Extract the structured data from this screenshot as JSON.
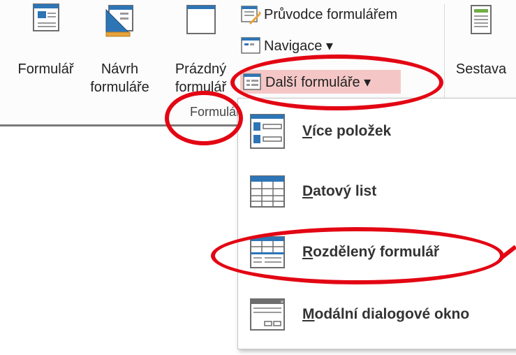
{
  "ribbon": {
    "buttons": {
      "formular": "Formulář",
      "navrh_line1": "Návrh",
      "navrh_line2": "formuláře",
      "prazdny_line1": "Prázdný",
      "prazdny_line2": "formulář",
      "sestava": "Sestava"
    },
    "small": {
      "pruvodce": "Průvodce formulářem",
      "navigace": "Navigace ▾",
      "dalsi": "Další formuláře ▾"
    },
    "group_label": "Formuláře"
  },
  "dropdown": {
    "items": [
      {
        "first": "V",
        "rest": "íce položek"
      },
      {
        "first": "D",
        "rest": "atový list"
      },
      {
        "first": "R",
        "rest": "ozdělený formulář"
      },
      {
        "first": "M",
        "rest": "odální dialogové okno"
      }
    ]
  },
  "colors": {
    "annotation": "#e30613",
    "highlight": "#f4c7c6",
    "accent": "#2e75b6"
  }
}
